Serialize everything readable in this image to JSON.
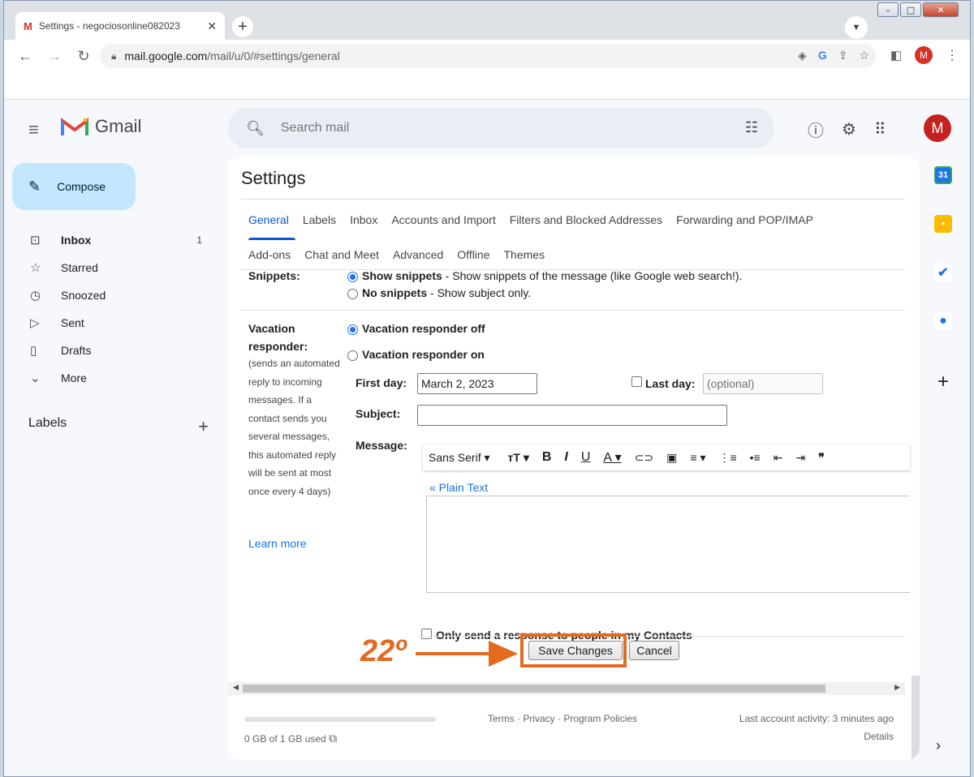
{
  "browser": {
    "tab_title": "Settings - negociosonline082023",
    "url_host": "mail.google.com",
    "url_path": "/mail/u/0/#settings/general",
    "avatar_initial": "M"
  },
  "gmail": {
    "brand": "Gmail",
    "search_placeholder": "Search mail",
    "compose_label": "Compose",
    "account_initial": "M",
    "nav": [
      {
        "label": "Inbox",
        "count": "1",
        "icon": "inbox-icon"
      },
      {
        "label": "Starred",
        "icon": "star-icon"
      },
      {
        "label": "Snoozed",
        "icon": "clock-icon"
      },
      {
        "label": "Sent",
        "icon": "send-icon"
      },
      {
        "label": "Drafts",
        "icon": "draft-icon"
      },
      {
        "label": "More",
        "icon": "chevron-down-icon"
      }
    ],
    "labels_header": "Labels"
  },
  "settings": {
    "title": "Settings",
    "tabs_row1": [
      "General",
      "Labels",
      "Inbox",
      "Accounts and Import",
      "Filters and Blocked Addresses",
      "Forwarding and POP/IMAP"
    ],
    "tabs_row2": [
      "Add-ons",
      "Chat and Meet",
      "Advanced",
      "Offline",
      "Themes"
    ],
    "snippets": {
      "label": "Snippets:",
      "show_bold": "Show snippets",
      "show_rest": " - Show snippets of the message (like Google web search!).",
      "none_bold": "No snippets",
      "none_rest": " - Show subject only."
    },
    "vacation": {
      "label_line1": "Vacation",
      "label_line2": "responder:",
      "description": "(sends an automated reply to incoming messages. If a contact sends you several messages, this automated reply will be sent at most once every 4 days)",
      "learn_more": "Learn more",
      "off_label": "Vacation responder off",
      "on_label": "Vacation responder on",
      "first_day_label": "First day:",
      "first_day_value": "March 2, 2023",
      "last_day_label": "Last day:",
      "last_day_placeholder": "(optional)",
      "subject_label": "Subject:",
      "message_label": "Message:",
      "font_name": "Sans Serif",
      "plain_text_link": "« Plain Text",
      "contacts_only_label": "Only send a response to people in my Contacts"
    },
    "save_button": "Save Changes",
    "cancel_button": "Cancel"
  },
  "footer": {
    "storage": "0 GB of 1 GB used",
    "links": "Terms · Privacy · Program Policies",
    "last_activity": "Last account activity: 3 minutes ago",
    "details": "Details"
  },
  "annotation": {
    "step_label": "22º",
    "color": "#e46a20"
  }
}
